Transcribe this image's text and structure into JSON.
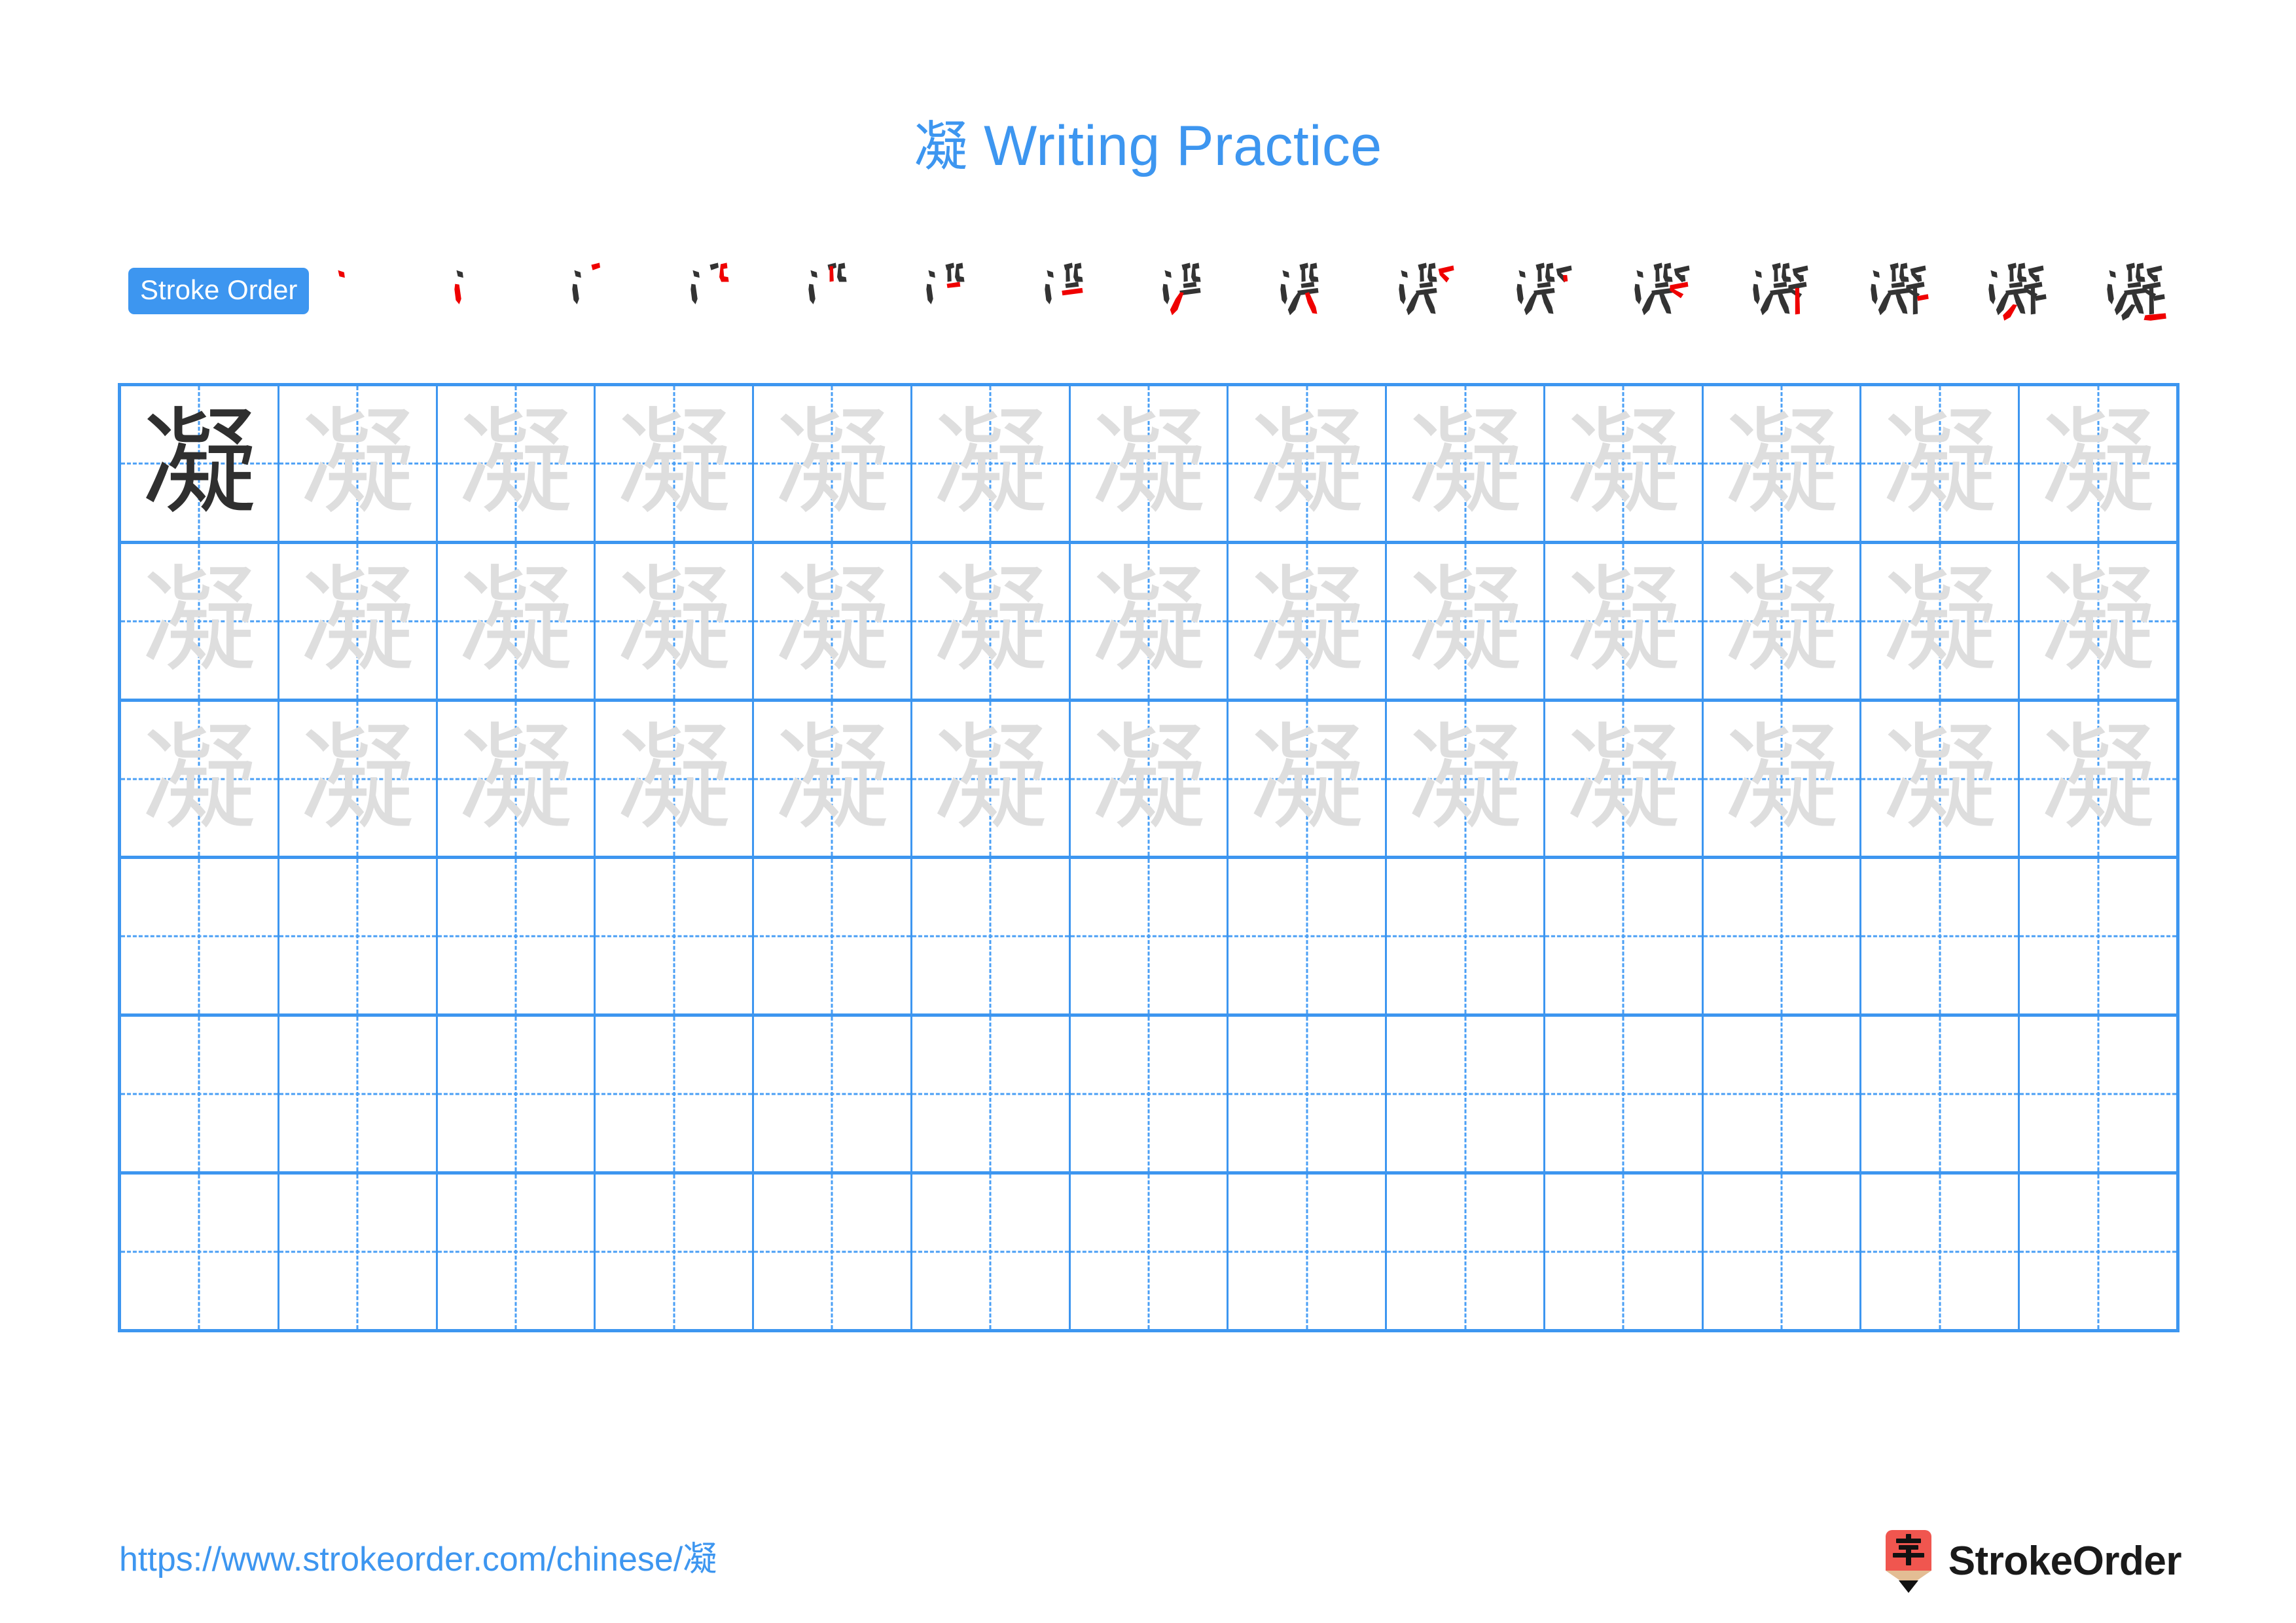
{
  "page": {
    "character": "凝",
    "title": "凝 Writing Practice",
    "title_character": "凝",
    "title_text": " Writing Practice",
    "accent_color": "#3d96f0",
    "grid_line_color": "#3d96f0",
    "trace_char_color": "#dedede",
    "dark_char_color": "#2f2f2f",
    "stroke_done_color": "#333333",
    "stroke_new_color": "#ef0000"
  },
  "stroke_order": {
    "label": "Stroke Order",
    "total_strokes": 16,
    "steps": [
      {
        "index": 1,
        "char": "凝",
        "new_stroke": "dot"
      },
      {
        "index": 2,
        "char": "凝",
        "new_stroke": "slant-stroke"
      },
      {
        "index": 3,
        "char": "凝",
        "new_stroke": "short-slant"
      },
      {
        "index": 4,
        "char": "凝",
        "new_stroke": "horizontal-hook"
      },
      {
        "index": 5,
        "char": "凝",
        "new_stroke": "vertical"
      },
      {
        "index": 6,
        "char": "凝",
        "new_stroke": "short-horizontal"
      },
      {
        "index": 7,
        "char": "凝",
        "new_stroke": "horizontal"
      },
      {
        "index": 8,
        "char": "凝",
        "new_stroke": "left-falling"
      },
      {
        "index": 9,
        "char": "凝",
        "new_stroke": "right-falling"
      },
      {
        "index": 10,
        "char": "凝",
        "new_stroke": "horizontal-turn"
      },
      {
        "index": 11,
        "char": "凝",
        "new_stroke": "short-slant-right"
      },
      {
        "index": 12,
        "char": "凝",
        "new_stroke": "horizontal-bend"
      },
      {
        "index": 13,
        "char": "凝",
        "new_stroke": "vertical-stem"
      },
      {
        "index": 14,
        "char": "凝",
        "new_stroke": "short-horizontal-right"
      },
      {
        "index": 15,
        "char": "凝",
        "new_stroke": "left-falling-bottom"
      },
      {
        "index": 16,
        "char": "凝",
        "new_stroke": "horizontal-sweep"
      }
    ]
  },
  "practice_grid": {
    "columns": 13,
    "rows": 6,
    "cells": [
      [
        "凝",
        "凝",
        "凝",
        "凝",
        "凝",
        "凝",
        "凝",
        "凝",
        "凝",
        "凝",
        "凝",
        "凝",
        "凝"
      ],
      [
        "凝",
        "凝",
        "凝",
        "凝",
        "凝",
        "凝",
        "凝",
        "凝",
        "凝",
        "凝",
        "凝",
        "凝",
        "凝"
      ],
      [
        "凝",
        "凝",
        "凝",
        "凝",
        "凝",
        "凝",
        "凝",
        "凝",
        "凝",
        "凝",
        "凝",
        "凝",
        "凝"
      ],
      [
        "",
        "",
        "",
        "",
        "",
        "",
        "",
        "",
        "",
        "",
        "",
        "",
        ""
      ],
      [
        "",
        "",
        "",
        "",
        "",
        "",
        "",
        "",
        "",
        "",
        "",
        "",
        ""
      ],
      [
        "",
        "",
        "",
        "",
        "",
        "",
        "",
        "",
        "",
        "",
        "",
        "",
        ""
      ]
    ],
    "cell_styles": [
      [
        "dark",
        "trace",
        "trace",
        "trace",
        "trace",
        "trace",
        "trace",
        "trace",
        "trace",
        "trace",
        "trace",
        "trace",
        "trace"
      ],
      [
        "trace",
        "trace",
        "trace",
        "trace",
        "trace",
        "trace",
        "trace",
        "trace",
        "trace",
        "trace",
        "trace",
        "trace",
        "trace"
      ],
      [
        "trace",
        "trace",
        "trace",
        "trace",
        "trace",
        "trace",
        "trace",
        "trace",
        "trace",
        "trace",
        "trace",
        "trace",
        "trace"
      ],
      [
        "blank",
        "blank",
        "blank",
        "blank",
        "blank",
        "blank",
        "blank",
        "blank",
        "blank",
        "blank",
        "blank",
        "blank",
        "blank"
      ],
      [
        "blank",
        "blank",
        "blank",
        "blank",
        "blank",
        "blank",
        "blank",
        "blank",
        "blank",
        "blank",
        "blank",
        "blank",
        "blank"
      ],
      [
        "blank",
        "blank",
        "blank",
        "blank",
        "blank",
        "blank",
        "blank",
        "blank",
        "blank",
        "blank",
        "blank",
        "blank",
        "blank"
      ]
    ]
  },
  "footer": {
    "url": "https://www.strokeorder.com/chinese/凝",
    "brand_name": "StrokeOrder",
    "logo_char": "字",
    "logo_body_color": "#f0564f",
    "logo_tip_color": "#e3bd94"
  }
}
